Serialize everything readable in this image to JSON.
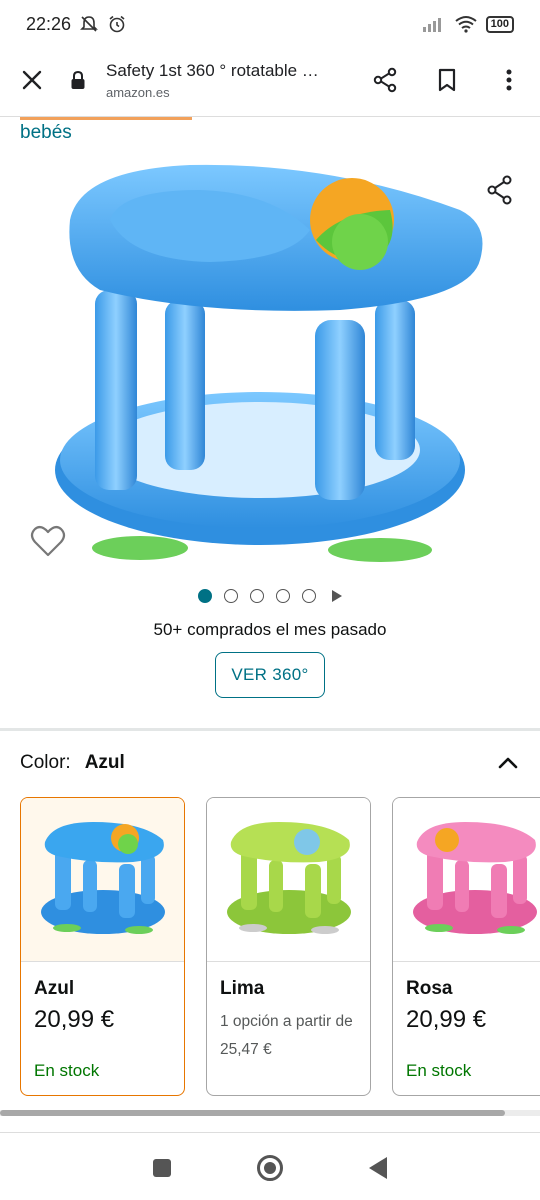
{
  "status_bar": {
    "time": "22:26",
    "battery": "100"
  },
  "browser": {
    "page_title": "Safety 1st 360 ° rotatable …",
    "domain": "amazon.es"
  },
  "breadcrumb": "bebés",
  "gallery": {
    "dot_count": 5,
    "active_index": 0
  },
  "social_proof": "50+ comprados el mes pasado",
  "view360_label": "VER 360°",
  "color": {
    "label": "Color:",
    "selected": "Azul"
  },
  "swatches": [
    {
      "name": "Azul",
      "price": "20,99 €",
      "stock": "En stock",
      "color": "#3aa6ef",
      "selected": true
    },
    {
      "name": "Lima",
      "sub": "1 opción a partir de 25,47 €",
      "color": "#a8d84a",
      "selected": false
    },
    {
      "name": "Rosa",
      "price": "20,99 €",
      "stock": "En stock",
      "color": "#f07cb4",
      "selected": false
    }
  ],
  "colors": {
    "link": "#007185",
    "in_stock": "#007600",
    "selected_border": "#e77600"
  }
}
